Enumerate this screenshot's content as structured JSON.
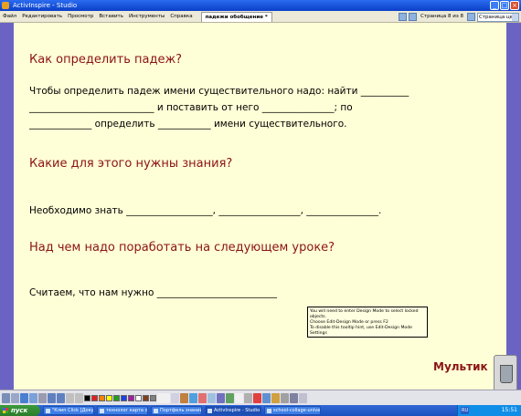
{
  "window": {
    "title": "ActivInspire - Studio"
  },
  "menu": {
    "items": [
      "Файл",
      "Редактировать",
      "Просмотр",
      "Вставить",
      "Инструменты",
      "Справка"
    ],
    "doc_tab": "падежи обобщение *",
    "page_info": "Страница 8 из 8",
    "page_width_select": "Страница целиком"
  },
  "page": {
    "heading1": "Как определить падеж?",
    "para1_line1": "Чтобы определить падеж имени существительного надо: найти __________",
    "para1_line2": "__________________________ и поставить от него _______________; по",
    "para1_line3": "_____________ определить ___________ имени существительного.",
    "heading2": "Какие для этого нужны знания?",
    "para2": "Необходимо знать __________________, _________________, _______________.",
    "heading3": "Над чем надо поработать на следующем уроке?",
    "para3": "Считаем, что нам нужно _________________________",
    "cartoon_label": "Мультик"
  },
  "tooltip": {
    "line1": "You will need to enter Design Mode to select locked objects.",
    "line2": "Choose Edit-Design Mode or press F2",
    "line3": "To disable this tooltip hint, use Edit-Design Mode Settings"
  },
  "taskbar": {
    "start": "пуск",
    "buttons": [
      "\"Клип Click [Докум...",
      "технолог карта отс...",
      "Портфель знаний.d...",
      "ActivInspire - Studio",
      "school-collage-univer..."
    ],
    "lang": "RU",
    "clock": "15:51"
  },
  "colors": {
    "page_bg": "#ffffd7",
    "heading": "#8b1313",
    "desktop": "#6a63c4"
  },
  "icons": [
    "window-app-icon",
    "minimize-icon",
    "maximize-icon",
    "close-icon",
    "trash-icon",
    "start-logo-icon"
  ]
}
